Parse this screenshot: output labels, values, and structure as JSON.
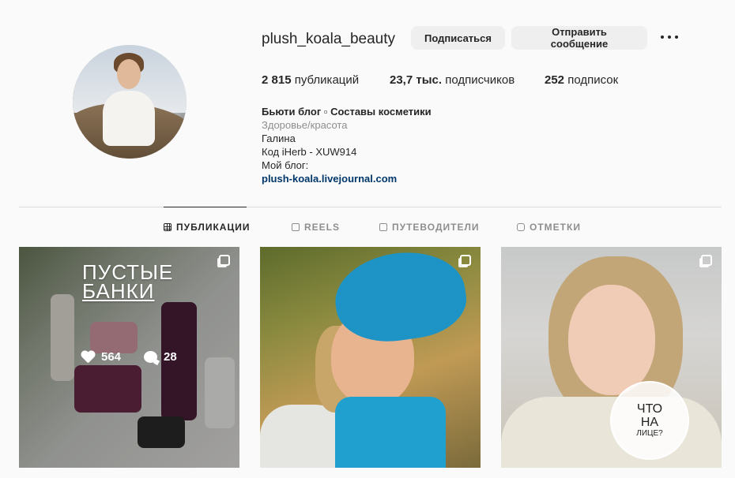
{
  "profile": {
    "username": "plush_koala_beauty",
    "follow_label": "Подписаться",
    "message_label": "Отправить сообщение"
  },
  "stats": {
    "posts_count": "2 815",
    "posts_label": "публикаций",
    "followers_count": "23,7 тыс.",
    "followers_label": "подписчиков",
    "following_count": "252",
    "following_label": "подписок"
  },
  "bio": {
    "name": "Бьюти блог ▫ Составы косметики",
    "category": "Здоровье/красота",
    "line1": "Галина",
    "line2": "Код iHerb - XUW914",
    "line3": "Мой блог:",
    "link": "plush-koala.livejournal.com"
  },
  "tabs": [
    {
      "label": "ПУБЛИКАЦИИ",
      "active": true
    },
    {
      "label": "REELS",
      "active": false
    },
    {
      "label": "ПУТЕВОДИТЕЛИ",
      "active": false
    },
    {
      "label": "ОТМЕТКИ",
      "active": false
    }
  ],
  "posts": [
    {
      "overlay_line1": "ПУСТЫЕ",
      "overlay_line2": "БАНКИ",
      "likes": "564",
      "comments": "28",
      "hover": true
    },
    {
      "hover": false
    },
    {
      "stamp_line1": "ЧТО",
      "stamp_line2": "НА",
      "stamp_line3": "ЛИЦЕ?",
      "hover": false
    }
  ],
  "colors": {
    "background": "#fafafa",
    "link": "#00376b",
    "button_bg": "#efefef",
    "muted": "#8e8e8e"
  }
}
